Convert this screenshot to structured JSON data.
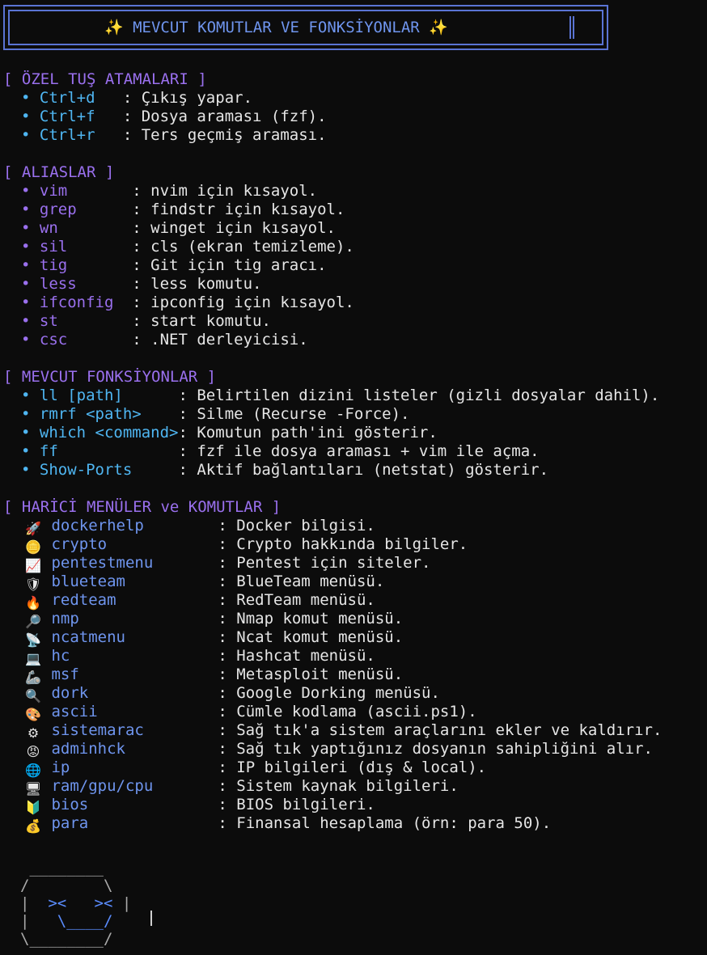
{
  "banner": {
    "title": "✨ MEVCUT KOMUTLAR VE FONKSİYONLAR ✨"
  },
  "keybindings": {
    "header": "[ ÖZEL TUŞ ATAMALARI ]",
    "items": [
      {
        "key": "Ctrl+d",
        "desc": ": Çıkış yapar."
      },
      {
        "key": "Ctrl+f",
        "desc": ": Dosya araması (fzf)."
      },
      {
        "key": "Ctrl+r",
        "desc": ": Ters geçmiş araması."
      }
    ]
  },
  "aliases": {
    "header": "[ ALIASLAR ]",
    "items": [
      {
        "name": "vim",
        "desc": ": nvim için kısayol."
      },
      {
        "name": "grep",
        "desc": ": findstr için kısayol."
      },
      {
        "name": "wn",
        "desc": ": winget için kısayol."
      },
      {
        "name": "sil",
        "desc": ": cls (ekran temizleme)."
      },
      {
        "name": "tig",
        "desc": ": Git için tig aracı."
      },
      {
        "name": "less",
        "desc": ": less komutu."
      },
      {
        "name": "ifconfig",
        "desc": ": ipconfig için kısayol."
      },
      {
        "name": "st",
        "desc": ": start komutu."
      },
      {
        "name": "csc",
        "desc": ": .NET derleyicisi."
      }
    ]
  },
  "functions": {
    "header": "[ MEVCUT FONKSİYONLAR ]",
    "items": [
      {
        "name": "ll [path]",
        "desc": ": Belirtilen dizini listeler (gizli dosyalar dahil)."
      },
      {
        "name": "rmrf <path>",
        "desc": ": Silme (Recurse -Force)."
      },
      {
        "name": "which <command>",
        "desc": ": Komutun path'ini gösterir."
      },
      {
        "name": "ff",
        "desc": ": fzf ile dosya araması + vim ile açma."
      },
      {
        "name": "Show-Ports",
        "desc": ": Aktif bağlantıları (netstat) gösterir."
      }
    ]
  },
  "menus": {
    "header": "[ HARİCİ MENÜLER ve KOMUTLAR ]",
    "items": [
      {
        "icon": "rocket-icon",
        "glyph": "🚀",
        "name": "dockerhelp",
        "desc": ": Docker bilgisi."
      },
      {
        "icon": "coin-icon",
        "glyph": "🪙",
        "name": "crypto",
        "desc": ": Crypto hakkında bilgiler."
      },
      {
        "icon": "chart-increasing-icon",
        "glyph": "📈",
        "name": "pentestmenu",
        "desc": ": Pentest için siteler."
      },
      {
        "icon": "shield-icon",
        "glyph": "🛡",
        "name": "blueteam",
        "desc": ": BlueTeam menüsü."
      },
      {
        "icon": "fire-icon",
        "glyph": "🔥",
        "name": "redteam",
        "desc": ": RedTeam menüsü."
      },
      {
        "icon": "magnifier-icon",
        "glyph": "🔎",
        "name": "nmp",
        "desc": ": Nmap komut menüsü."
      },
      {
        "icon": "satellite-dish-icon",
        "glyph": "📡",
        "name": "ncatmenu",
        "desc": ": Ncat komut menüsü."
      },
      {
        "icon": "laptop-icon",
        "glyph": "💻",
        "name": "hc",
        "desc": ": Hashcat menüsü."
      },
      {
        "icon": "mechanical-arm-icon",
        "glyph": "🦾",
        "name": "msf",
        "desc": ": Metasploit menüsü."
      },
      {
        "icon": "search-icon",
        "glyph": "🔍",
        "name": "dork",
        "desc": ": Google Dorking menüsü."
      },
      {
        "icon": "palette-icon",
        "glyph": "🎨",
        "name": "ascii",
        "desc": ": Cümle kodlama (ascii.ps1)."
      },
      {
        "icon": "gear-icon",
        "glyph": "⚙",
        "name": "sistemarac",
        "desc": ": Sağ tık'a sistem araçlarını ekler ve kaldırır."
      },
      {
        "icon": "angry-face-icon",
        "glyph": "😡",
        "name": "adminhck",
        "desc": ": Sağ tık yaptığınız dosyanın sahipliğini alır."
      },
      {
        "icon": "globe-icon",
        "glyph": "🌐",
        "name": "ip",
        "desc": ": IP bilgileri (dış & local)."
      },
      {
        "icon": "desktop-computer-icon",
        "glyph": "🖥",
        "name": "ram/gpu/cpu",
        "desc": ": Sistem kaynak bilgileri."
      },
      {
        "icon": "beginner-badge-icon",
        "glyph": "🔰",
        "name": "bios",
        "desc": ": BIOS bilgileri."
      },
      {
        "icon": "money-bag-icon",
        "glyph": "💰",
        "name": "para",
        "desc": ": Finansal hesaplama (örn: para 50)."
      }
    ]
  },
  "ascii_art": {
    "line1": " ________",
    "line2": "/        \\",
    "line3_pre": "|  ",
    "line3_eyes": "><   ><",
    "line3_post": " |",
    "line4_pre": "|   ",
    "line4_mouth": "\\____/",
    "line4_post": "   ",
    "line5": "\\________/"
  }
}
